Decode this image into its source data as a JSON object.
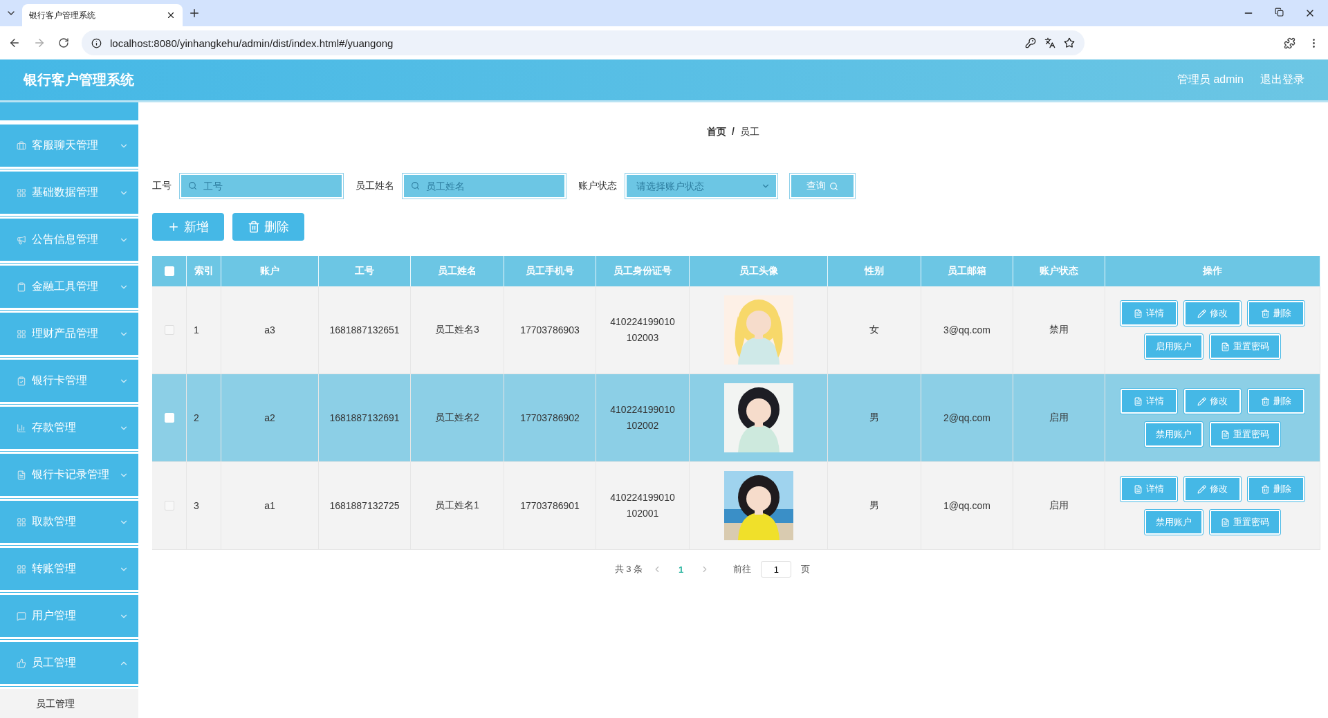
{
  "browser": {
    "tab_title": "银行客户管理系统",
    "url": "localhost:8080/yinhangkehu/admin/dist/index.html#/yuangong"
  },
  "header": {
    "title": "银行客户管理系统",
    "user": "管理员 admin",
    "logout": "退出登录"
  },
  "sidebar": {
    "items": [
      {
        "label": "客服聊天管理",
        "expanded": false
      },
      {
        "label": "基础数据管理",
        "expanded": false
      },
      {
        "label": "公告信息管理",
        "expanded": false
      },
      {
        "label": "金融工具管理",
        "expanded": false
      },
      {
        "label": "理财产品管理",
        "expanded": false
      },
      {
        "label": "银行卡管理",
        "expanded": false
      },
      {
        "label": "存款管理",
        "expanded": false
      },
      {
        "label": "银行卡记录管理",
        "expanded": false
      },
      {
        "label": "取款管理",
        "expanded": false
      },
      {
        "label": "转账管理",
        "expanded": false
      },
      {
        "label": "用户管理",
        "expanded": false
      },
      {
        "label": "员工管理",
        "expanded": true,
        "children": [
          {
            "label": "员工管理"
          }
        ]
      }
    ]
  },
  "breadcrumb": {
    "items": [
      "首页",
      "员工"
    ],
    "separator": "/"
  },
  "search": {
    "fields": [
      {
        "label": "工号",
        "placeholder": "工号",
        "kind": "text"
      },
      {
        "label": "员工姓名",
        "placeholder": "员工姓名",
        "kind": "text"
      },
      {
        "label": "账户状态",
        "placeholder": "请选择账户状态",
        "kind": "select"
      }
    ],
    "button": "查询"
  },
  "actions": [
    {
      "label": "新增",
      "kind": "add"
    },
    {
      "label": "删除",
      "kind": "delete"
    }
  ],
  "table": {
    "select_all_checked": false,
    "columns": [
      "索引",
      "账户",
      "工号",
      "员工姓名",
      "员工手机号",
      "员工身份证号",
      "员工头像",
      "性别",
      "员工邮箱",
      "账户状态",
      "操作"
    ],
    "rows": [
      {
        "selected": false,
        "checked": false,
        "cells": [
          "1",
          "a3",
          "1681887132651",
          "员工姓名3",
          "17703786903",
          "410224199010102003"
        ],
        "avatar": {
          "kind": "picture"
        },
        "gender": "女",
        "email": "3@qq.com",
        "status": "禁用",
        "buttons": [
          {
            "label": "详情",
            "kind": "detail"
          },
          {
            "label": "修改",
            "kind": "edit"
          },
          {
            "label": "删除",
            "kind": "delete"
          },
          {
            "label": "启用账户",
            "kind": "toggle"
          },
          {
            "label": "重置密码",
            "kind": "reset"
          }
        ]
      },
      {
        "selected": true,
        "checked": false,
        "cells": [
          "2",
          "a2",
          "1681887132691",
          "员工姓名2",
          "17703786902",
          "410224199010102002"
        ],
        "avatar": {
          "kind": "picture"
        },
        "gender": "男",
        "email": "2@qq.com",
        "status": "启用",
        "buttons": [
          {
            "label": "详情",
            "kind": "detail"
          },
          {
            "label": "修改",
            "kind": "edit"
          },
          {
            "label": "删除",
            "kind": "delete"
          },
          {
            "label": "禁用账户",
            "kind": "toggle"
          },
          {
            "label": "重置密码",
            "kind": "reset"
          }
        ]
      },
      {
        "selected": false,
        "checked": false,
        "cells": [
          "3",
          "a1",
          "1681887132725",
          "员工姓名1",
          "17703786901",
          "410224199010102001"
        ],
        "avatar": {
          "kind": "picture"
        },
        "gender": "男",
        "email": "1@qq.com",
        "status": "启用",
        "buttons": [
          {
            "label": "详情",
            "kind": "detail"
          },
          {
            "label": "修改",
            "kind": "edit"
          },
          {
            "label": "删除",
            "kind": "delete"
          },
          {
            "label": "禁用账户",
            "kind": "toggle"
          },
          {
            "label": "重置密码",
            "kind": "reset"
          }
        ]
      }
    ]
  },
  "pagination": {
    "total": "共 3 条",
    "pages": [
      {
        "label": "1",
        "selected": true
      }
    ],
    "goto": "前往",
    "page_input": "1",
    "suffix": "页"
  }
}
